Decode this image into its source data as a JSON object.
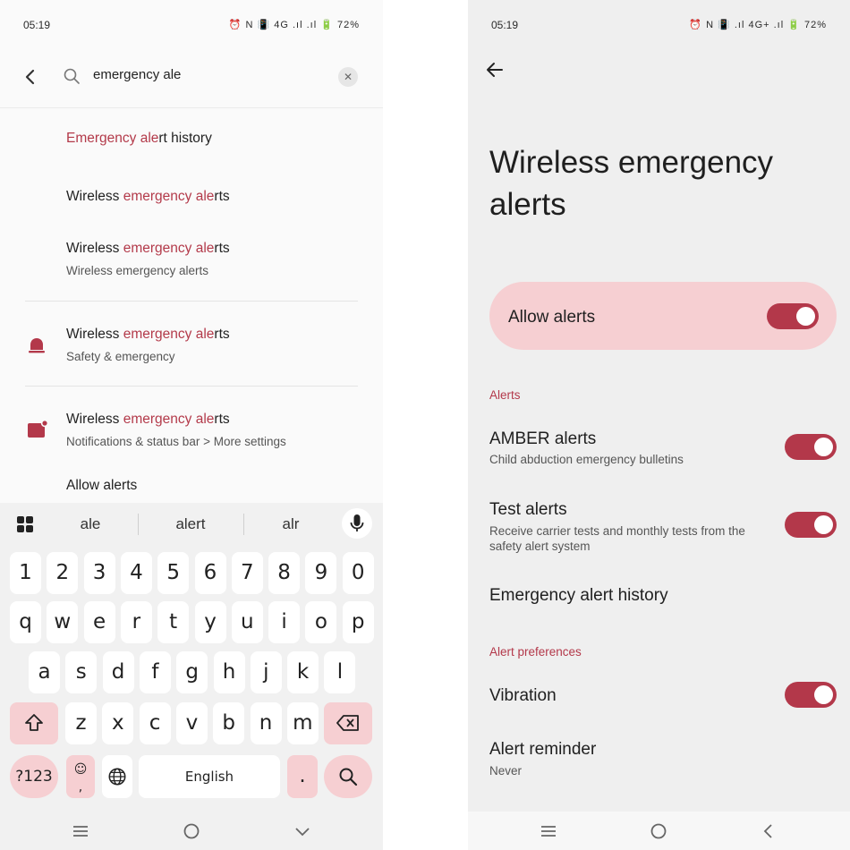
{
  "left": {
    "status": {
      "time": "05:19",
      "icons": "⏰ N 📳 4G .ıl .ıl 🔋 72%"
    },
    "search": {
      "query": "emergency ale"
    },
    "results": [
      {
        "pre": "",
        "hl": "Emergency ale",
        "post": "rt history",
        "sub": ""
      },
      {
        "pre": "Wireless ",
        "hl": "emergency ale",
        "post": "rts",
        "sub": ""
      },
      {
        "pre": "Wireless ",
        "hl": "emergency ale",
        "post": "rts",
        "sub": "Wireless emergency alerts"
      },
      {
        "pre": "Wireless ",
        "hl": "emergency ale",
        "post": "rts",
        "sub": "Safety & emergency"
      },
      {
        "pre": "Wireless ",
        "hl": "emergency ale",
        "post": "rts",
        "sub": "Notifications & status bar > More settings"
      },
      {
        "pre": "Allow alerts",
        "hl": "",
        "post": "",
        "sub": ""
      }
    ],
    "keyboard": {
      "suggestions": [
        "ale",
        "alert",
        "alr"
      ],
      "row1": [
        "1",
        "2",
        "3",
        "4",
        "5",
        "6",
        "7",
        "8",
        "9",
        "0"
      ],
      "row2": [
        "q",
        "w",
        "e",
        "r",
        "t",
        "y",
        "u",
        "i",
        "o",
        "p"
      ],
      "row3": [
        "a",
        "s",
        "d",
        "f",
        "g",
        "h",
        "j",
        "k",
        "l"
      ],
      "row4": [
        "z",
        "x",
        "c",
        "v",
        "b",
        "n",
        "m"
      ],
      "symbols": "?123",
      "emoji_comma": ",",
      "space": "English",
      "period": "."
    },
    "colors": {
      "highlight": "#b33a4a",
      "key_pink": "#f6cfd2"
    }
  },
  "right": {
    "status": {
      "time": "05:19",
      "icons": "⏰ N 📳 .ıl 4G+ .ıl 🔋 72%"
    },
    "title": "Wireless emergency alerts",
    "allow": {
      "label": "Allow alerts",
      "on": true
    },
    "section_alerts": "Alerts",
    "amber": {
      "title": "AMBER alerts",
      "sub": "Child abduction emergency bulletins",
      "on": true
    },
    "test": {
      "title": "Test alerts",
      "sub": "Receive carrier tests and monthly tests from the safety alert system",
      "on": true
    },
    "history": {
      "title": "Emergency alert history"
    },
    "section_prefs": "Alert preferences",
    "vibration": {
      "title": "Vibration",
      "on": true
    },
    "reminder": {
      "title": "Alert reminder",
      "sub": "Never"
    },
    "colors": {
      "accent": "#b3384a",
      "card": "#f6cfd2"
    }
  }
}
